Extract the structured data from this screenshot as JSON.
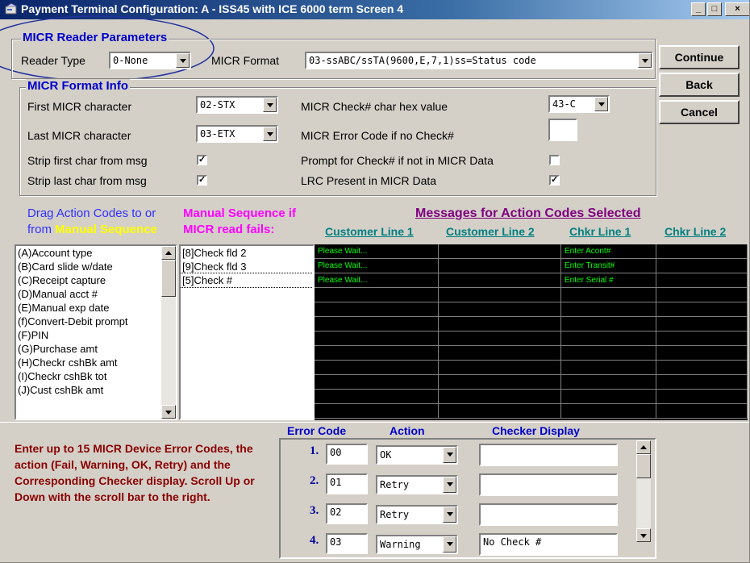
{
  "window": {
    "title": "Payment Terminal Configuration: A - ISS45 with ICE 6000 term  Screen 4",
    "min_label": "_",
    "max_label": "□",
    "close_label": "×"
  },
  "micr_params": {
    "group_title": "MICR Reader Parameters",
    "reader_type_label": "Reader Type",
    "reader_type_value": "0-None",
    "micr_format_label": "MICR Format",
    "micr_format_value": "03-ssABC/ssTA(9600,E,7,1)ss=Status code"
  },
  "buttons": {
    "continue": "Continue",
    "back": "Back",
    "cancel": "Cancel"
  },
  "micr_format_info": {
    "group_title": "MICR Format Info",
    "first_char_label": "First MICR character",
    "first_char_value": "02-STX",
    "last_char_label": "Last MICR character",
    "last_char_value": "03-ETX",
    "strip_first_label": "Strip first char from msg",
    "strip_last_label": "Strip last char from msg",
    "check_hex_label": "MICR Check# char hex value",
    "check_hex_value": "43-C",
    "error_code_label": "MICR Error Code if no Check#",
    "error_code_value": "",
    "prompt_label": "Prompt for Check# if not in MICR Data",
    "lrc_label": "LRC Present in MICR Data",
    "check_mark": "✓"
  },
  "action_section": {
    "drag_line1": "Drag Action Codes to or",
    "drag_line2_prefix": "from",
    "drag_line2_highlight": "Manual Sequence",
    "manual_seq_line1": "Manual Sequence if",
    "manual_seq_line2": "MICR read fails:",
    "messages_title": "Messages for Action Codes Selected",
    "columns": [
      "Customer Line 1",
      "Customer Line 2",
      "Chkr Line 1",
      "Chkr Line 2"
    ],
    "action_codes": [
      "(A)Account type",
      "(B)Card slide w/date",
      "(C)Receipt capture",
      "(D)Manual acct #",
      "(E)Manual exp date",
      "(f)Convert-Debit prompt",
      "(F)PIN",
      "(G)Purchase amt",
      "(H)Checkr cshBk amt",
      "(I)Checkr cshBk tot",
      "(J)Cust cshBk amt"
    ],
    "manual_sequence": [
      "[8]Check fld 2",
      "[9]Check fld 3",
      "[5]Check #"
    ],
    "messages": [
      [
        "Please Wait...",
        "",
        "Enter Acont#",
        ""
      ],
      [
        "Please Wait...",
        "",
        "Enter Transit#",
        ""
      ],
      [
        "Please Wait...",
        "",
        "Enter Serial #",
        ""
      ],
      [
        "",
        "",
        "",
        ""
      ],
      [
        "",
        "",
        "",
        ""
      ],
      [
        "",
        "",
        "",
        ""
      ],
      [
        "",
        "",
        "",
        ""
      ],
      [
        "",
        "",
        "",
        ""
      ],
      [
        "",
        "",
        "",
        ""
      ],
      [
        "",
        "",
        "",
        ""
      ],
      [
        "",
        "",
        "",
        ""
      ],
      [
        "",
        "",
        "",
        ""
      ]
    ]
  },
  "error_section": {
    "instructions": "Enter up to 15 MICR Device Error Codes, the action (Fail, Warning, OK, Retry) and the Corresponding Checker display.  Scroll Up or Down with the scroll bar to the right.",
    "headers": {
      "code": "Error Code",
      "action": "Action",
      "display": "Checker Display"
    },
    "rows": [
      {
        "num": "1.",
        "code": "00",
        "action": "OK",
        "display": ""
      },
      {
        "num": "2.",
        "code": "01",
        "action": "Retry",
        "display": ""
      },
      {
        "num": "3.",
        "code": "02",
        "action": "Retry",
        "display": ""
      },
      {
        "num": "4.",
        "code": "03",
        "action": "Warning",
        "display": "No Check #"
      }
    ]
  }
}
